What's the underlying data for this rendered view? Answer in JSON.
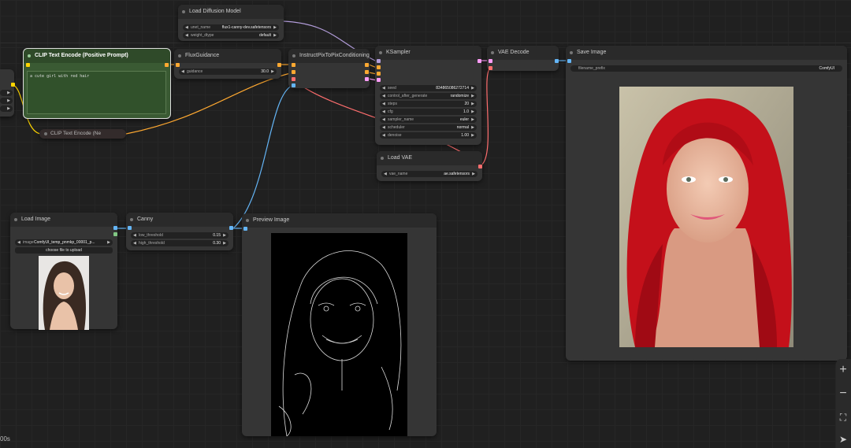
{
  "nodes": {
    "load_diffusion": {
      "title": "Load Diffusion Model",
      "unet_label": "unet_name",
      "unet_value": "flux1-canny-dev.safetensors",
      "dtype_label": "weight_dtype",
      "dtype_value": "default"
    },
    "clip_pos": {
      "title": "CLIP Text Encode (Positive Prompt)",
      "prompt": "a cute girl with red hair"
    },
    "clip_neg": {
      "title": "CLIP Text Encode (Ne"
    },
    "flux_guidance": {
      "title": "FluxGuidance",
      "guidance_label": "guidance",
      "guidance_value": "30.0"
    },
    "instruct": {
      "title": "InstructPixToPixConditioning"
    },
    "ksampler": {
      "title": "KSampler",
      "widgets": [
        {
          "label": "seed",
          "value": "834865086272714"
        },
        {
          "label": "control_after_generate",
          "value": "randomize"
        },
        {
          "label": "steps",
          "value": "20"
        },
        {
          "label": "cfg",
          "value": "1.0"
        },
        {
          "label": "sampler_name",
          "value": "euler"
        },
        {
          "label": "scheduler",
          "value": "normal"
        },
        {
          "label": "denoise",
          "value": "1.00"
        }
      ]
    },
    "vae_decode": {
      "title": "VAE Decode"
    },
    "load_vae": {
      "title": "Load VAE",
      "vae_label": "vae_name",
      "vae_value": "ae.safetensors"
    },
    "save_image": {
      "title": "Save Image",
      "prefix_label": "filename_prefix",
      "prefix_value": "ComfyUI"
    },
    "load_image": {
      "title": "Load Image",
      "image_label": "image",
      "image_value": "ComfyUI_temp_pnmkp_00001_p...",
      "upload_label": "choose file to upload"
    },
    "canny": {
      "title": "Canny",
      "low_label": "low_threshold",
      "low_value": "0.15",
      "high_label": "high_threshold",
      "high_value": "0.30"
    },
    "preview": {
      "title": "Preview Image"
    }
  },
  "status": {
    "time": "00s"
  },
  "toolbar": {
    "zoom_in": "+",
    "zoom_out": "−",
    "fit": "⛶",
    "locate": "➤"
  },
  "colors": {
    "wire_model": "#b39ddb",
    "wire_conditioning": "#ffa931",
    "wire_latent": "#ff9cf9",
    "wire_vae": "#ff6e6e",
    "wire_image": "#64b5f6",
    "wire_clip": "#ffd500",
    "node_green": "#3a5a33"
  }
}
